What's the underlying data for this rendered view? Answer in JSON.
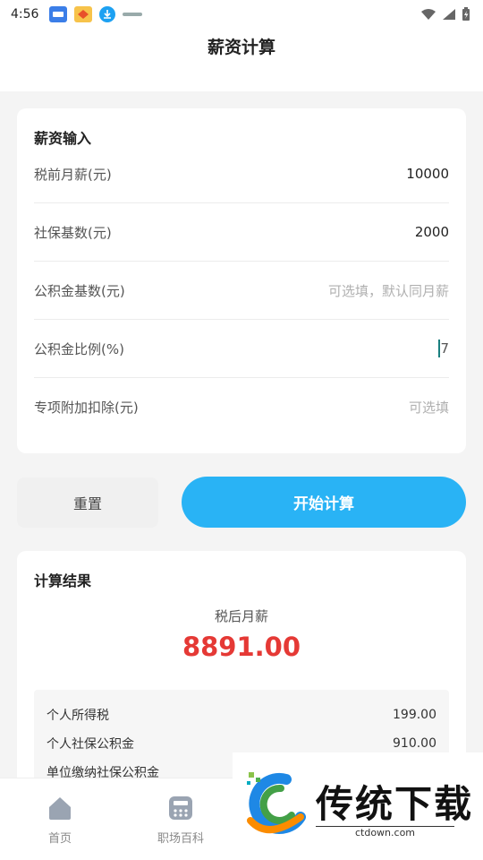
{
  "status_bar": {
    "time": "4:56"
  },
  "header": {
    "title": "薪资计算"
  },
  "input_card": {
    "title": "薪资输入",
    "fields": [
      {
        "label": "税前月薪(元)",
        "value": "10000",
        "placeholder": ""
      },
      {
        "label": "社保基数(元)",
        "value": "2000",
        "placeholder": ""
      },
      {
        "label": "公积金基数(元)",
        "value": "",
        "placeholder": "可选填，默认同月薪"
      },
      {
        "label": "公积金比例(%)",
        "value": "7",
        "placeholder": ""
      },
      {
        "label": "专项附加扣除(元)",
        "value": "",
        "placeholder": "可选填"
      }
    ]
  },
  "actions": {
    "reset_label": "重置",
    "calculate_label": "开始计算"
  },
  "result_card": {
    "title": "计算结果",
    "net_label": "税后月薪",
    "net_value": "8891.00",
    "details": [
      {
        "label": "个人所得税",
        "value": "199.00"
      },
      {
        "label": "个人社保公积金",
        "value": "910.00"
      },
      {
        "label": "单位缴纳社保公积金",
        "value": ""
      }
    ]
  },
  "bottom_nav": {
    "items": [
      {
        "label": "首页",
        "icon": "home-icon"
      },
      {
        "label": "职场百科",
        "icon": "calculator-icon"
      }
    ]
  },
  "watermark": {
    "text": "传统下载",
    "url": "ctdown.com"
  },
  "colors": {
    "accent": "#29b3f5",
    "net_value": "#e53935",
    "background": "#f4f4f4"
  }
}
